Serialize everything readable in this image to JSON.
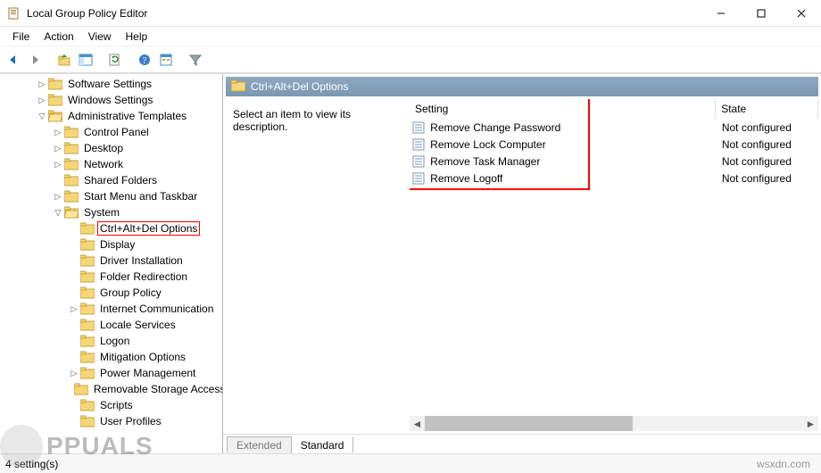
{
  "window": {
    "title": "Local Group Policy Editor"
  },
  "menubar": {
    "file": "File",
    "action": "Action",
    "view": "View",
    "help": "Help"
  },
  "tree": {
    "software_settings": "Software Settings",
    "windows_settings": "Windows Settings",
    "admin_templates": "Administrative Templates",
    "control_panel": "Control Panel",
    "desktop": "Desktop",
    "network": "Network",
    "shared_folders": "Shared Folders",
    "start_menu": "Start Menu and Taskbar",
    "system": "System",
    "ctrl_alt_del": "Ctrl+Alt+Del Options",
    "display": "Display",
    "driver_installation": "Driver Installation",
    "folder_redirection": "Folder Redirection",
    "group_policy": "Group Policy",
    "internet_comm": "Internet Communication",
    "locale_services": "Locale Services",
    "logon": "Logon",
    "mitigation_options": "Mitigation Options",
    "power_management": "Power Management",
    "removable_storage": "Removable Storage Access",
    "scripts": "Scripts",
    "user_profiles": "User Profiles"
  },
  "content": {
    "header_title": "Ctrl+Alt+Del Options",
    "description_prompt": "Select an item to view its description.",
    "columns": {
      "setting": "Setting",
      "state": "State"
    },
    "settings": [
      {
        "name": "Remove Change Password",
        "state": "Not configured"
      },
      {
        "name": "Remove Lock Computer",
        "state": "Not configured"
      },
      {
        "name": "Remove Task Manager",
        "state": "Not configured"
      },
      {
        "name": "Remove Logoff",
        "state": "Not configured"
      }
    ],
    "tabs": {
      "extended": "Extended",
      "standard": "Standard"
    }
  },
  "statusbar": {
    "count": "4 setting(s)"
  },
  "watermark": {
    "domain": "wsxdn.com",
    "logo_text": "PPUALS"
  }
}
